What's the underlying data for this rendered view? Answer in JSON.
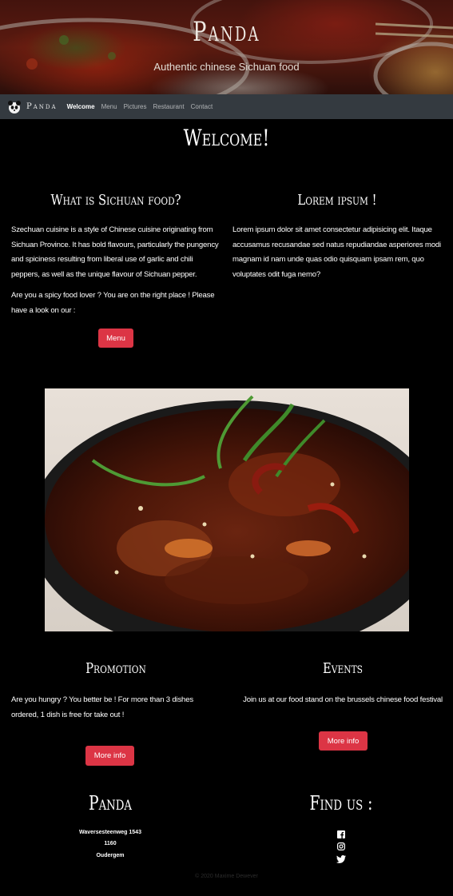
{
  "hero": {
    "title": "Panda",
    "subtitle": "Authentic chinese Sichuan food"
  },
  "navbar": {
    "brand": "Panda",
    "links": [
      "Welcome",
      "Menu",
      "Pictures",
      "Restaurant",
      "Contact"
    ],
    "active": "Welcome"
  },
  "main": {
    "title": "Welcome!",
    "sichuan": {
      "title": "What is Sichuan food?",
      "text": "Szechuan cuisine is a style of Chinese cuisine originating from Sichuan Province. It has bold flavours, particularly the pungency and spiciness resulting from liberal use of garlic and chili peppers, as well as the unique flavour of Sichuan pepper.",
      "text2": "Are you a spicy food lover ? You are on the right place ! Please have a look on our :",
      "button": "Menu"
    },
    "lorem": {
      "title": "Lorem ipsum !",
      "text": "Lorem ipsum dolor sit amet consectetur adipisicing elit. Itaque accusamus recusandae sed natus repudiandae asperiores modi magnam id nam unde quas odio quisquam ipsam rem, quo voluptates odit fuga nemo?"
    },
    "promotion": {
      "title": "Promotion",
      "text": "Are you hungry ? You better be ! For more than 3 dishes ordered, 1 dish is free for take out !",
      "button": "More info"
    },
    "events": {
      "title": "Events",
      "text": "Join us at our food stand on the brussels chinese food festival",
      "button": "More info"
    }
  },
  "footer": {
    "brand": "Panda",
    "address": [
      "Waversesteenweg 1543",
      "1160",
      "Oudergem"
    ],
    "find_us": "Find us :",
    "social": [
      "facebook-icon",
      "instagram-icon",
      "twitter-icon"
    ],
    "copyright": "© 2020 Maxime Dewever"
  },
  "colors": {
    "accent": "#dc3545",
    "navbar": "#343a40",
    "background": "#000000"
  }
}
